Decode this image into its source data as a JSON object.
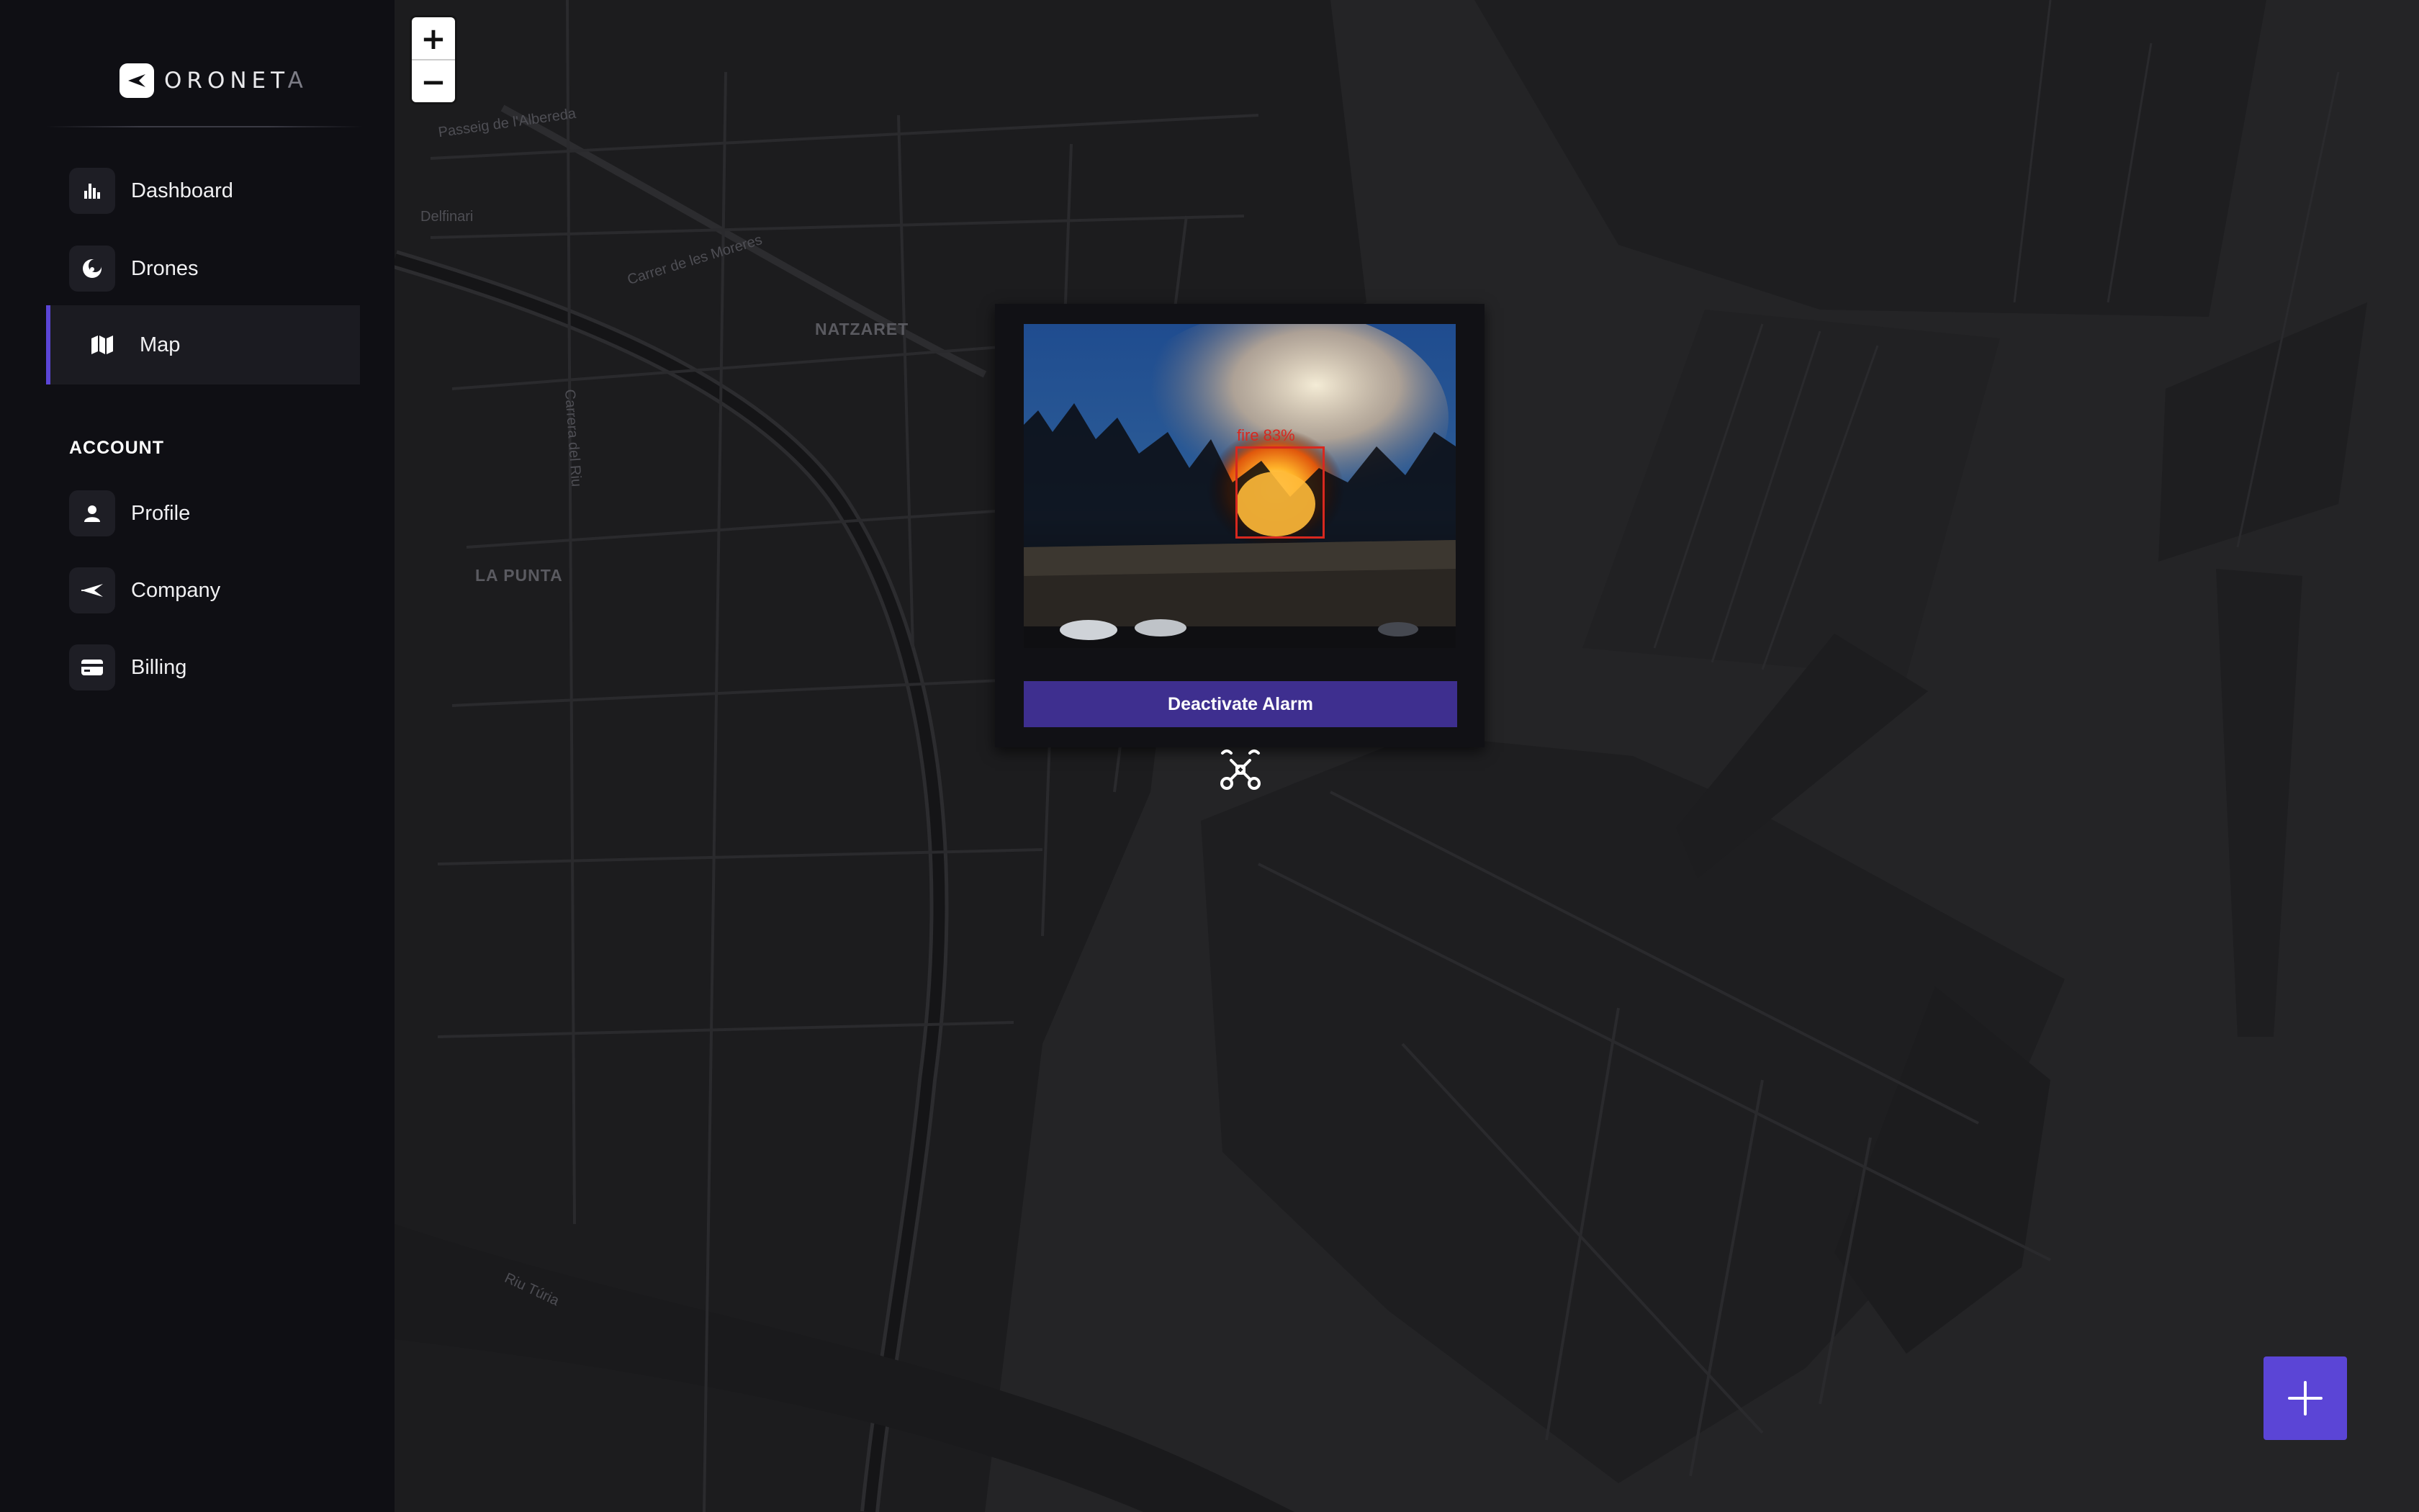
{
  "brand": {
    "name_main": "ORONET",
    "name_dim": "A"
  },
  "sidebar": {
    "items": [
      {
        "label": "Dashboard",
        "icon": "bar-chart-icon"
      },
      {
        "label": "Drones",
        "icon": "drone-icon"
      },
      {
        "label": "Map",
        "icon": "map-icon",
        "active": true
      }
    ],
    "account_title": "ACCOUNT",
    "account_items": [
      {
        "label": "Profile",
        "icon": "user-icon"
      },
      {
        "label": "Company",
        "icon": "plane-icon"
      },
      {
        "label": "Billing",
        "icon": "credit-card-icon"
      }
    ]
  },
  "map": {
    "zoom_in_label": "+",
    "zoom_out_label": "−",
    "areas": [
      "NATZARET",
      "LA PUNTA"
    ],
    "streets": [
      "Passeig de l'Albereda",
      "Carrer de les Moreres",
      "Carrera del Riu",
      "Riu Túria",
      "Delfinari"
    ]
  },
  "alarm_popup": {
    "detection_label": "fire 83%",
    "button_label": "Deactivate Alarm"
  },
  "colors": {
    "accent": "#5b45d6",
    "button": "#3e2f8f",
    "detection": "#d8281f",
    "sidebar_bg": "#0f0f14",
    "map_bg": "#242426"
  }
}
